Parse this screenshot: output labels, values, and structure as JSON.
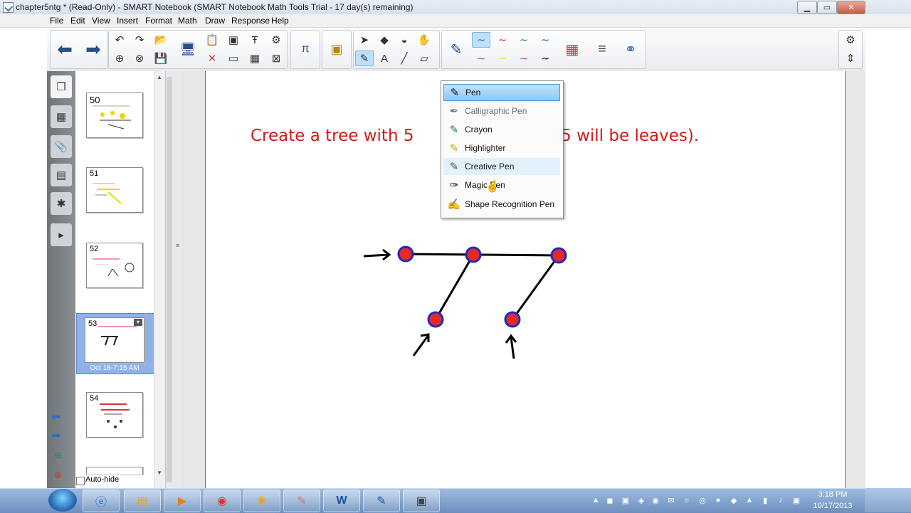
{
  "window": {
    "title": "chapter5ntg * (Read-Only) - SMART Notebook (SMART Notebook Math Tools Trial - 17 day(s) remaining)"
  },
  "menu": [
    "File",
    "Edit",
    "View",
    "Insert",
    "Format",
    "Math",
    "Draw",
    "Response",
    "Help"
  ],
  "page": {
    "text": "Create a tree with 5                    f the 5 will be leaves)."
  },
  "pen_menu": {
    "items": [
      {
        "label": "Pen",
        "icon": "pen-icon",
        "state": "selected"
      },
      {
        "label": "Calligraphic Pen",
        "icon": "calligraphic-pen-icon",
        "state": "disabled"
      },
      {
        "label": "Crayon",
        "icon": "crayon-icon",
        "state": "normal"
      },
      {
        "label": "Highlighter",
        "icon": "highlighter-icon",
        "state": "normal"
      },
      {
        "label": "Creative Pen",
        "icon": "creative-pen-icon",
        "state": "hover"
      },
      {
        "label": "Magic Pen",
        "icon": "magic-pen-icon",
        "state": "normal"
      },
      {
        "label": "Shape Recognition Pen",
        "icon": "shape-recognition-pen-icon",
        "state": "normal"
      }
    ]
  },
  "thumbnails": [
    {
      "number": "50",
      "date": ""
    },
    {
      "number": "51",
      "date": ""
    },
    {
      "number": "52",
      "date": ""
    },
    {
      "number": "53",
      "date": "Oct 18-7:15 AM"
    },
    {
      "number": "54",
      "date": ""
    }
  ],
  "sidebar": {
    "autohide_label": "Auto-hide"
  },
  "clock": {
    "time": "3:18 PM",
    "date": "10/17/2013"
  },
  "colors": {
    "text_red": "#d11a1a",
    "node_fill": "#e52828",
    "node_ring": "#1f2bbf",
    "accent_select": "#bfe0fa"
  }
}
